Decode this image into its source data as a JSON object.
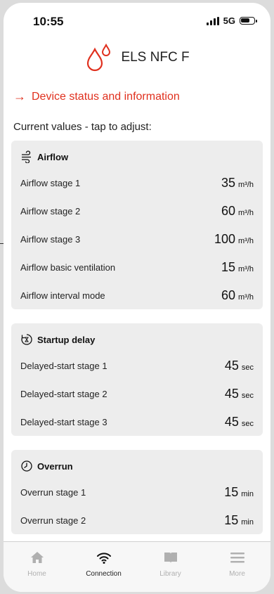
{
  "status_bar": {
    "time": "10:55",
    "network": "5G"
  },
  "header": {
    "title": "ELS NFC F",
    "logo_icon": "drops-icon"
  },
  "status_link": {
    "label": "Device status and information"
  },
  "intro": "Current values - tap to adjust:",
  "sections": [
    {
      "title": "Airflow",
      "icon": "airflow-icon",
      "rows": [
        {
          "label": "Airflow stage 1",
          "value": "35",
          "unit": "m³/h"
        },
        {
          "label": "Airflow stage 2",
          "value": "60",
          "unit": "m³/h"
        },
        {
          "label": "Airflow stage 3",
          "value": "100",
          "unit": "m³/h"
        },
        {
          "label": "Airflow basic ventilation",
          "value": "15",
          "unit": "m³/h"
        },
        {
          "label": "Airflow interval mode",
          "value": "60",
          "unit": "m³/h"
        }
      ]
    },
    {
      "title": "Startup delay",
      "icon": "timer-icon",
      "rows": [
        {
          "label": "Delayed-start stage 1",
          "value": "45",
          "unit": "sec"
        },
        {
          "label": "Delayed-start stage 2",
          "value": "45",
          "unit": "sec"
        },
        {
          "label": "Delayed-start stage 3",
          "value": "45",
          "unit": "sec"
        }
      ]
    },
    {
      "title": "Overrun",
      "icon": "clock-icon",
      "rows": [
        {
          "label": "Overrun stage 1",
          "value": "15",
          "unit": "min"
        },
        {
          "label": "Overrun stage 2",
          "value": "15",
          "unit": "min"
        }
      ]
    }
  ],
  "tabs": [
    {
      "label": "Home",
      "icon": "home-icon",
      "active": false
    },
    {
      "label": "Connection",
      "icon": "wifi-icon",
      "active": true
    },
    {
      "label": "Library",
      "icon": "book-icon",
      "active": false
    },
    {
      "label": "More",
      "icon": "menu-icon",
      "active": false
    }
  ],
  "colors": {
    "accent": "#e0301e",
    "panel": "#ededed",
    "inactive_tab": "#b0b0b0"
  }
}
